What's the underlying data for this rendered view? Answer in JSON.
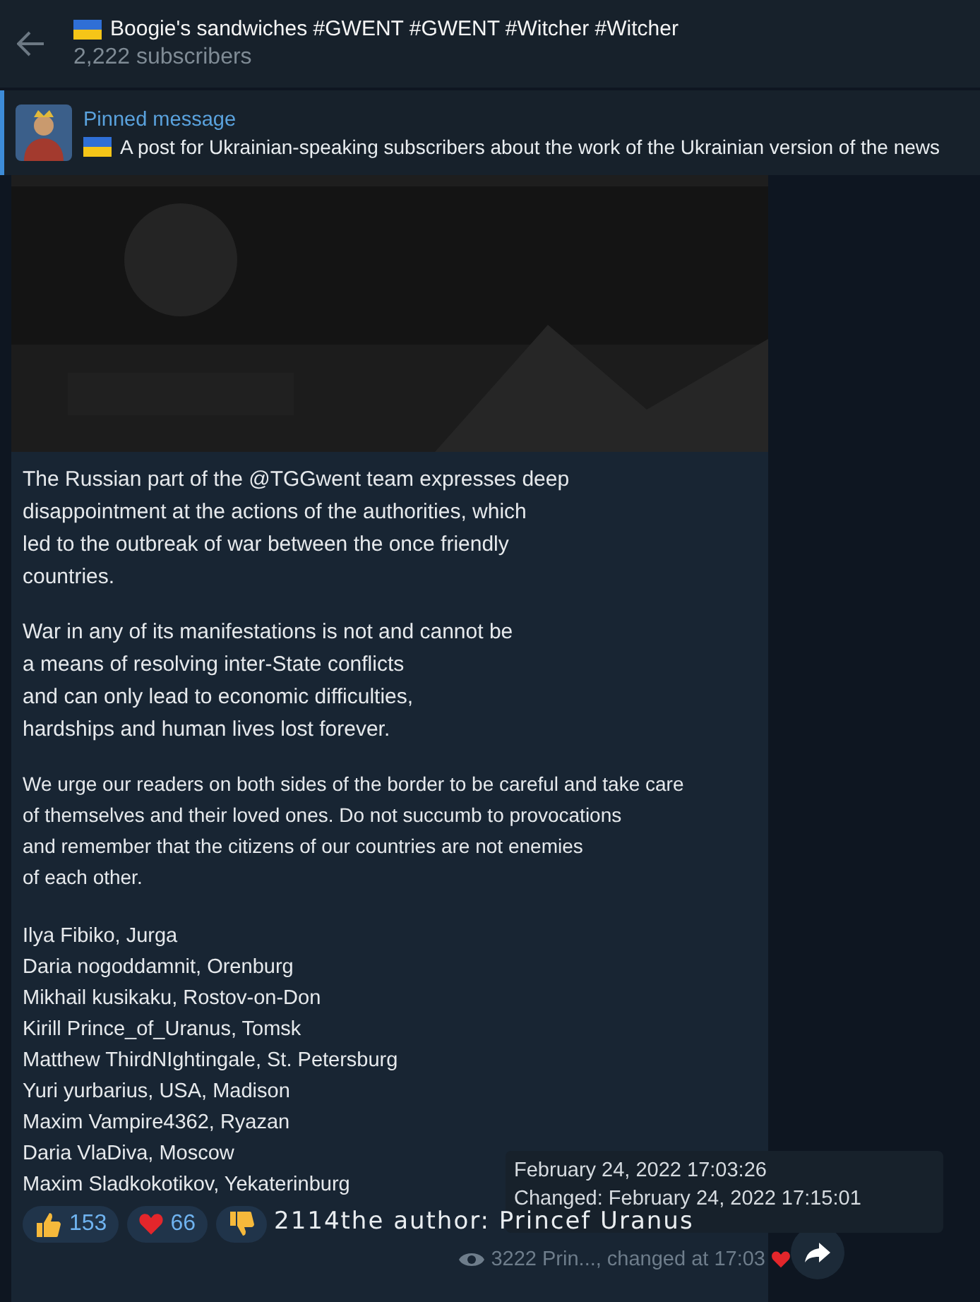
{
  "header": {
    "title": "Boogie's sandwiches #GWENT #GWENT #Witcher #Witcher",
    "subscribers": "2,222 subscribers"
  },
  "pinned": {
    "label": "Pinned message",
    "text": "A post for Ukrainian-speaking subscribers about the work of the Ukrainian version of the news"
  },
  "message": {
    "paragraphs": [
      [
        "The Russian part of the @TGGwent team expresses deep",
        "disappointment at the actions of the authorities, which",
        "led to the outbreak of war between the once friendly",
        "countries."
      ],
      [
        "War in any of its manifestations is not and cannot be",
        "a means of resolving inter-State conflicts",
        "and can only lead to economic difficulties,",
        "hardships and human lives lost forever."
      ],
      [
        "We urge our readers on both sides of the border to be careful and take care",
        "of themselves and their loved ones. Do not succumb to provocations",
        "and remember that the citizens of our countries are not enemies",
        "of each other."
      ]
    ],
    "signatures": [
      "Ilya Fibiko, Jurga",
      "Daria nogoddamnit, Orenburg",
      "Mikhail kusikaku, Rostov-on-Don",
      "Kirill Prince_of_Uranus, Tomsk",
      "Matthew ThirdNIghtingale, St. Petersburg",
      "Yuri yurbarius, USA, Madison",
      "Maxim Vampire4362, Ryazan",
      "Daria VlaDiva, Moscow",
      "Maxim Sladkokotikov, Yekaterinburg"
    ],
    "reactions": [
      {
        "kind": "thumbs_up",
        "count": "153"
      },
      {
        "kind": "heart",
        "count": "66"
      },
      {
        "kind": "thumbs_down"
      }
    ],
    "overlay_text": "2114the author: Princef Uranus",
    "footer": {
      "views": "3222",
      "text": "Prin..., changed at 17:03"
    }
  },
  "tooltip": {
    "lines": [
      "February 24, 2022 17:03:26",
      "Changed: February 24, 2022 17:15:01"
    ]
  }
}
